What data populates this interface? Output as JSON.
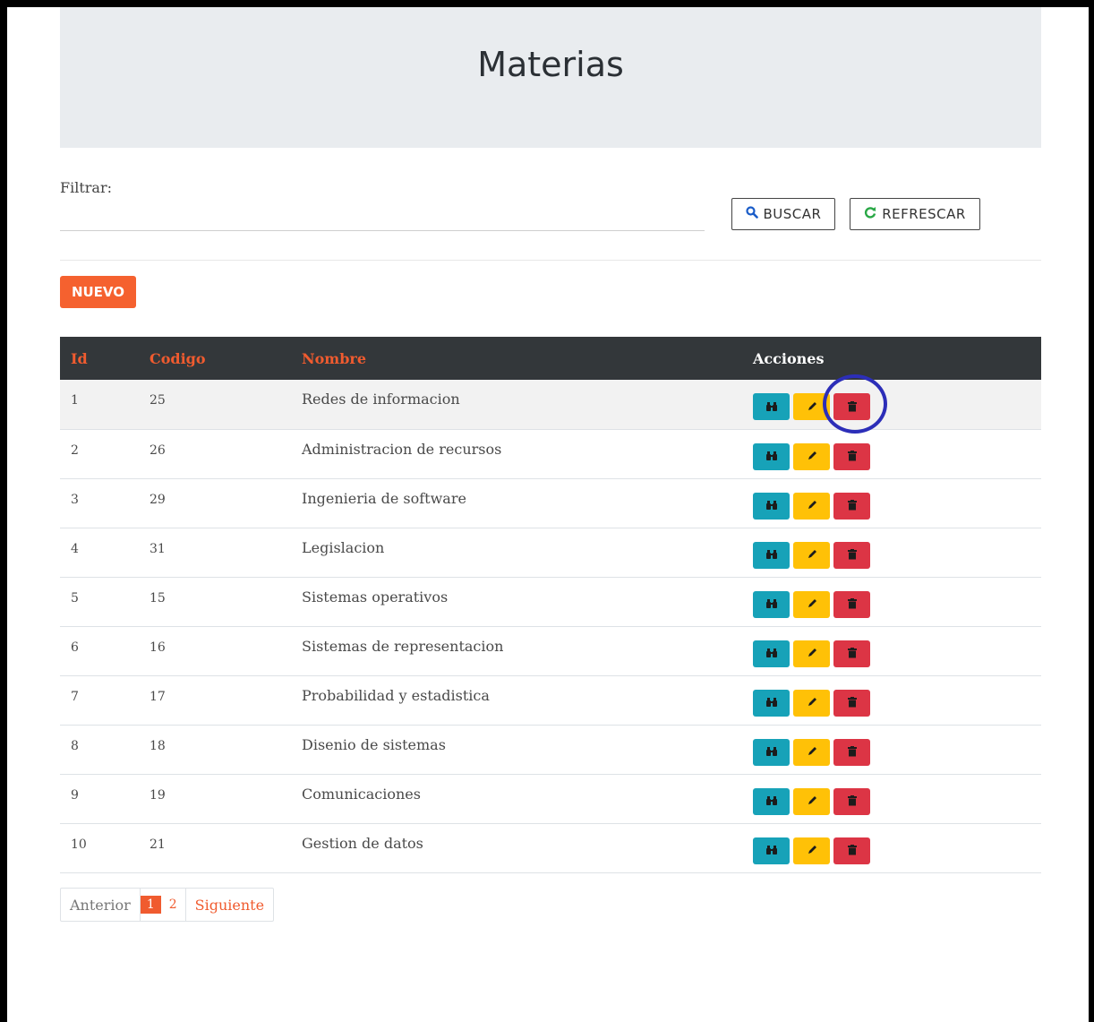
{
  "page": {
    "title": "Materias"
  },
  "filter": {
    "label": "Filtrar:",
    "value": "",
    "placeholder": ""
  },
  "buttons": {
    "buscar": "BUSCAR",
    "refrescar": "REFRESCAR",
    "nuevo": "NUEVO"
  },
  "table": {
    "headers": {
      "id": "Id",
      "codigo": "Codigo",
      "nombre": "Nombre",
      "acciones": "Acciones"
    },
    "rows": [
      {
        "id": "1",
        "codigo": "25",
        "nombre": "Redes de informacion"
      },
      {
        "id": "2",
        "codigo": "26",
        "nombre": "Administracion de recursos"
      },
      {
        "id": "3",
        "codigo": "29",
        "nombre": "Ingenieria de software"
      },
      {
        "id": "4",
        "codigo": "31",
        "nombre": "Legislacion"
      },
      {
        "id": "5",
        "codigo": "15",
        "nombre": "Sistemas operativos"
      },
      {
        "id": "6",
        "codigo": "16",
        "nombre": "Sistemas de representacion"
      },
      {
        "id": "7",
        "codigo": "17",
        "nombre": "Probabilidad y estadistica"
      },
      {
        "id": "8",
        "codigo": "18",
        "nombre": "Disenio de sistemas"
      },
      {
        "id": "9",
        "codigo": "19",
        "nombre": "Comunicaciones"
      },
      {
        "id": "10",
        "codigo": "21",
        "nombre": "Gestion de datos"
      }
    ],
    "action_icons": [
      "binoculars-icon",
      "pencil-icon",
      "trash-icon"
    ]
  },
  "pagination": {
    "prev": "Anterior",
    "pages": [
      "1",
      "2"
    ],
    "active": "1",
    "next": "Siguiente"
  },
  "colors": {
    "accent": "#f05b2f",
    "header_bg": "#33373a",
    "view_btn": "#17a2b8",
    "edit_btn": "#ffc107",
    "delete_btn": "#dc3545",
    "annotation_circle": "#2c2eb8"
  }
}
